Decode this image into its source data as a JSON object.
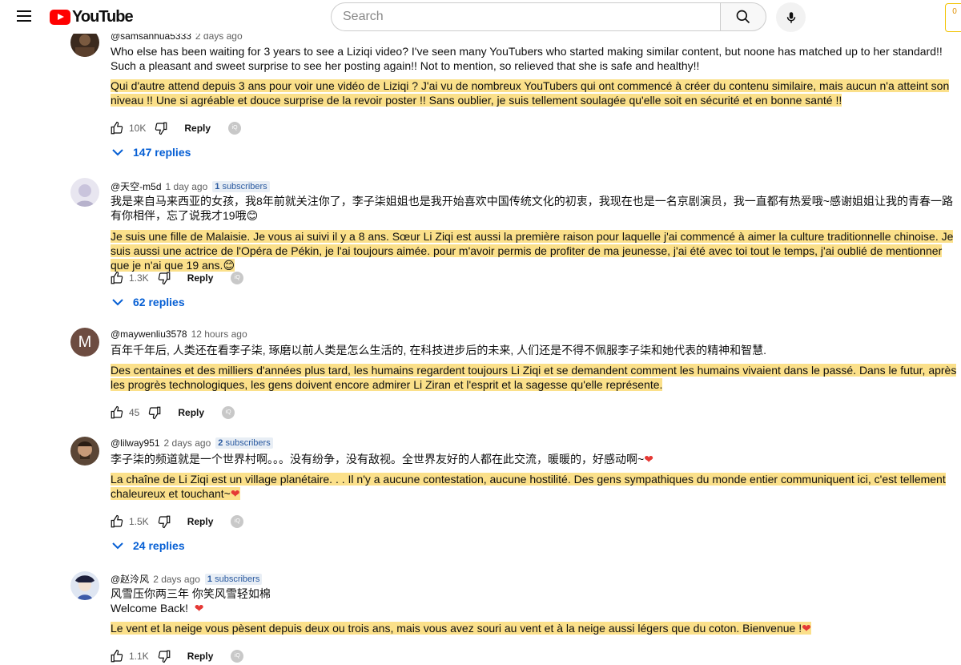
{
  "header": {
    "logo_text": "YouTube",
    "search_placeholder": "Search",
    "ext_label": "0"
  },
  "comments": [
    {
      "author": "@samsanhua5333",
      "time": "2 days ago",
      "text": "Who else has been waiting for 3 years to see a Liziqi video? I've seen many YouTubers who started making similar content, but noone has matched up to her standard!! Such a pleasant and sweet surprise to see her posting again!! Not to mention, so relieved that she is safe and healthy!!",
      "translation": "Qui d'autre attend depuis 3 ans pour voir une vidéo de Liziqi ? J'ai vu de nombreux YouTubers qui ont commencé à créer du contenu similaire, mais aucun n'a atteint son niveau !! Une si agréable et douce surprise de la revoir poster !! Sans oublier, je suis tellement soulagée qu'elle soit en sécurité et en bonne santé !!",
      "likes": "10K",
      "reply_label": "Reply",
      "replies": "147 replies"
    },
    {
      "author": "@天空-m5d",
      "time": "1 day ago",
      "subs_count": "1",
      "subs_label": "subscribers",
      "text": "我是来自马来西亚的女孩，我8年前就关注你了，李子柒姐姐也是我开始喜欢中国传统文化的初衷，我现在也是一名京剧演员，我一直都有热爱哦~感谢姐姐让我的青春一路有你相伴，忘了说我才19哦😊",
      "translation": "Je suis une fille de Malaisie. Je vous ai suivi il y a 8 ans. Sœur Li Ziqi est aussi la première raison pour laquelle j'ai commencé à aimer la culture traditionnelle chinoise. Je suis aussi une actrice de l'Opéra de Pékin, je l'ai toujours aimée. pour m'avoir permis de profiter de ma jeunesse, j'ai été avec toi tout le temps, j'ai oublié de mentionner que je n'ai que 19 ans.😊",
      "likes": "1.3K",
      "reply_label": "Reply",
      "replies": "62 replies"
    },
    {
      "author": "@maywenliu3578",
      "time": "12 hours ago",
      "avatar_letter": "M",
      "text": "百年千年后, 人类还在看李子柒, 琢磨以前人类是怎么生活的, 在科技进步后的未来, 人们还是不得不佩服李子柒和她代表的精神和智慧.",
      "translation": "Des centaines et des milliers d'années plus tard, les humains regardent toujours Li Ziqi et se demandent comment les humains vivaient dans le passé. Dans le futur, après les progrès technologiques, les gens doivent encore admirer Li Ziran et l'esprit et la sagesse qu'elle représente.",
      "likes": "45",
      "reply_label": "Reply"
    },
    {
      "author": "@lilway951",
      "time": "2 days ago",
      "subs_count": "2",
      "subs_label": "subscribers",
      "text": "李子柒的频道就是一个世界村啊。。。没有纷争，没有敌视。全世界友好的人都在此交流，暖暖的，好感动啊~",
      "translation": "La chaîne de Li Ziqi est un village planétaire. . . Il n'y a aucune contestation, aucune hostilité. Des gens sympathiques du monde entier communiquent ici, c'est tellement chaleureux et touchant~",
      "likes": "1.5K",
      "reply_label": "Reply",
      "replies": "24 replies"
    },
    {
      "author": "@赵泠风",
      "time": "2 days ago",
      "subs_count": "1",
      "subs_label": "subscribers",
      "text_line1": "风雪压你两三年 你笑风雪轻如棉",
      "text_line2": "Welcome Back!",
      "translation": "Le vent et la neige vous pèsent depuis deux ou trois ans, mais vous avez souri au vent et à la neige aussi légers que du coton. Bienvenue !",
      "likes": "1.1K",
      "reply_label": "Reply"
    }
  ]
}
